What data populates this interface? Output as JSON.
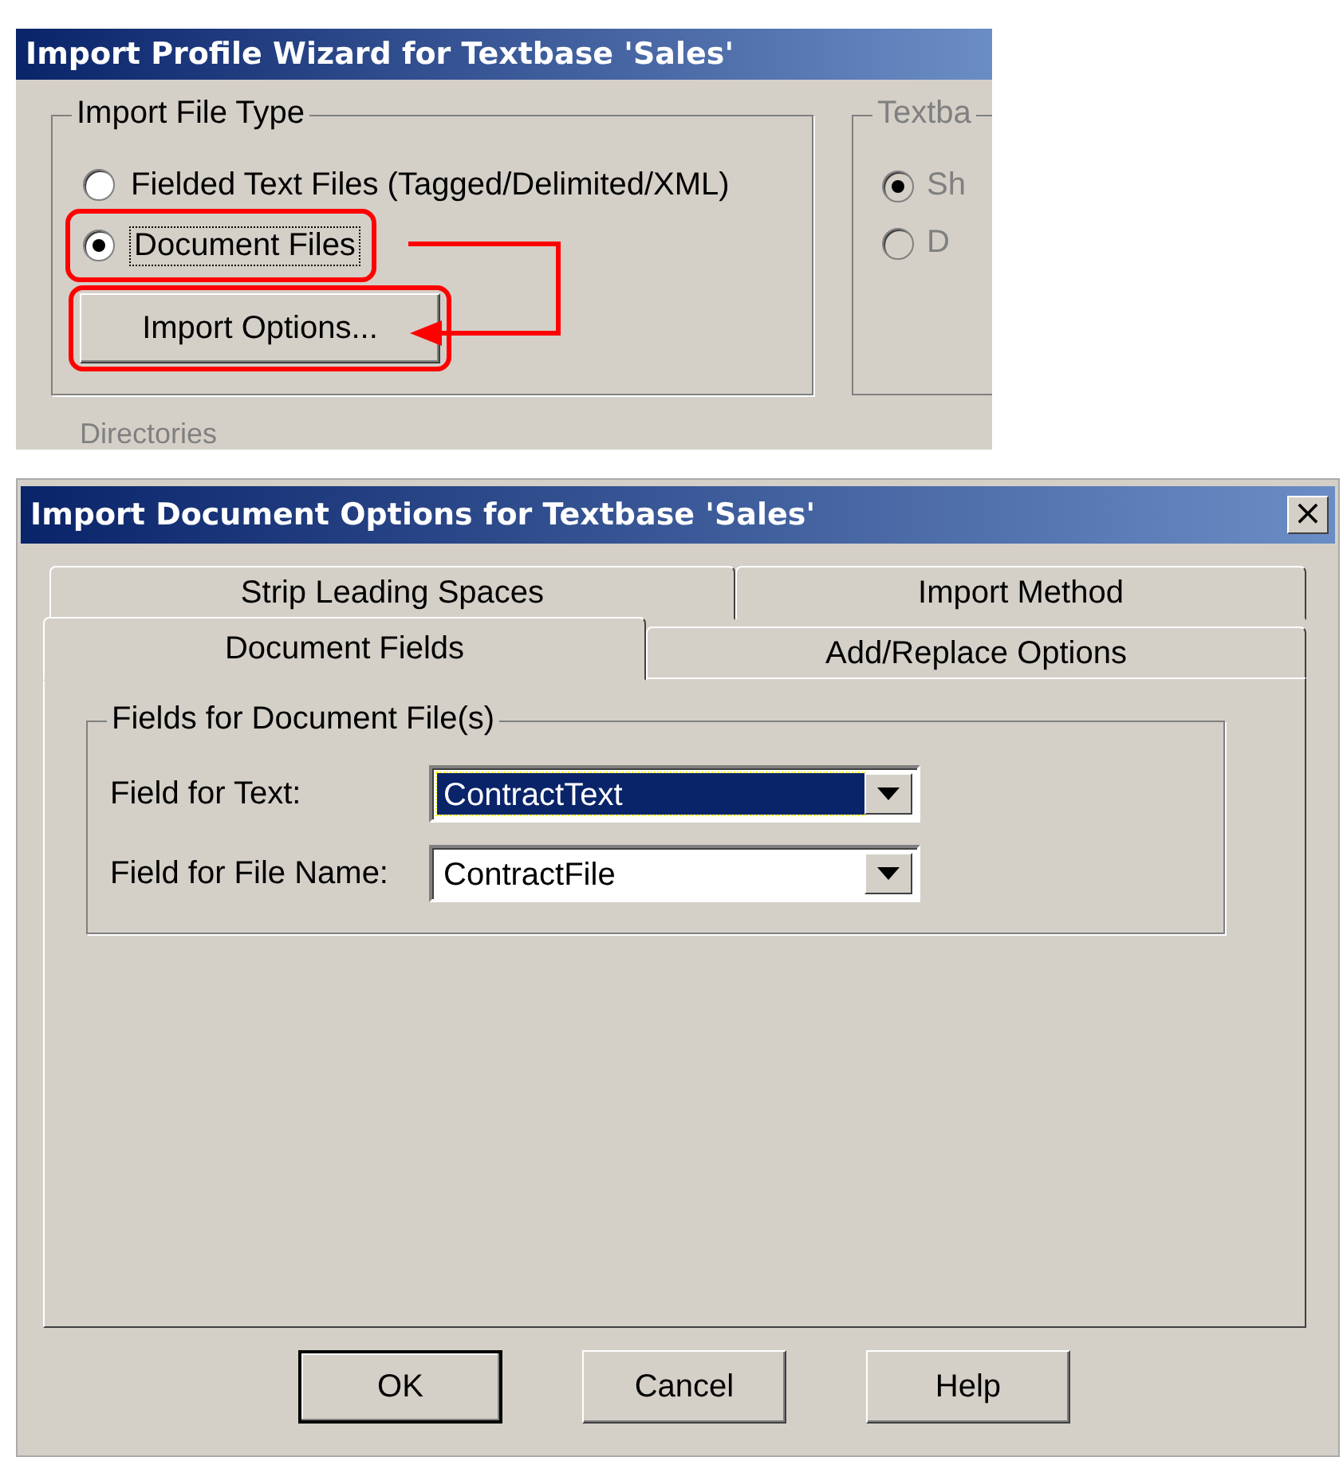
{
  "wizard": {
    "title": "Import Profile Wizard for Textbase 'Sales'",
    "file_type_group": {
      "label": "Import File Type",
      "options": [
        {
          "label": "Fielded Text Files (Tagged/Delimited/XML)",
          "selected": false,
          "highlighted": false
        },
        {
          "label": "Document Files",
          "selected": true,
          "highlighted": true
        }
      ],
      "button": {
        "label": "Import Options...",
        "highlighted": true
      }
    },
    "textbase_group": {
      "label": "Textba",
      "options": [
        {
          "label": "Sh",
          "selected": true
        },
        {
          "label": "D",
          "selected": false
        }
      ]
    },
    "directories_label": "Directories"
  },
  "dialog": {
    "title": "Import Document Options for Textbase 'Sales'",
    "close": "×",
    "tab_rows": [
      [
        {
          "label": "Strip Leading Spaces",
          "selected": false
        },
        {
          "label": "Import Method",
          "selected": false
        }
      ],
      [
        {
          "label": "Document Fields",
          "selected": true
        },
        {
          "label": "Add/Replace Options",
          "selected": false
        }
      ]
    ],
    "group": {
      "label": "Fields for Document File(s)",
      "fields": [
        {
          "label": "Field for Text:",
          "value": "ContractText",
          "focused": true
        },
        {
          "label": "Field for File Name:",
          "value": "ContractFile",
          "focused": false
        }
      ]
    },
    "buttons": [
      {
        "label": "OK",
        "default": true
      },
      {
        "label": "Cancel",
        "default": false
      },
      {
        "label": "Help",
        "default": false
      }
    ]
  }
}
